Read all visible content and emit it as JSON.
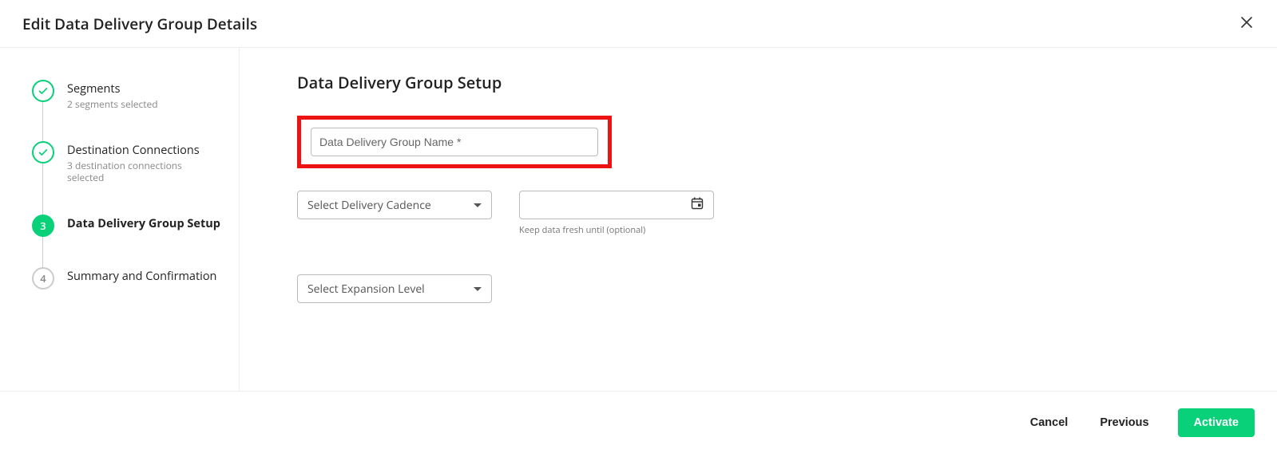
{
  "header": {
    "title": "Edit Data Delivery Group Details"
  },
  "steps": [
    {
      "title": "Segments",
      "sub": "2 segments selected"
    },
    {
      "title": "Destination Connections",
      "sub": "3 destination connections selected"
    },
    {
      "number": "3",
      "title": "Data Delivery Group Setup"
    },
    {
      "number": "4",
      "title": "Summary and Confirmation"
    }
  ],
  "main": {
    "title": "Data Delivery Group Setup",
    "name_placeholder": "Data Delivery Group Name *",
    "cadence_placeholder": "Select Delivery Cadence",
    "date_help": "Keep data fresh until (optional)",
    "expansion_placeholder": "Select Expansion Level"
  },
  "footer": {
    "cancel": "Cancel",
    "previous": "Previous",
    "activate": "Activate"
  }
}
